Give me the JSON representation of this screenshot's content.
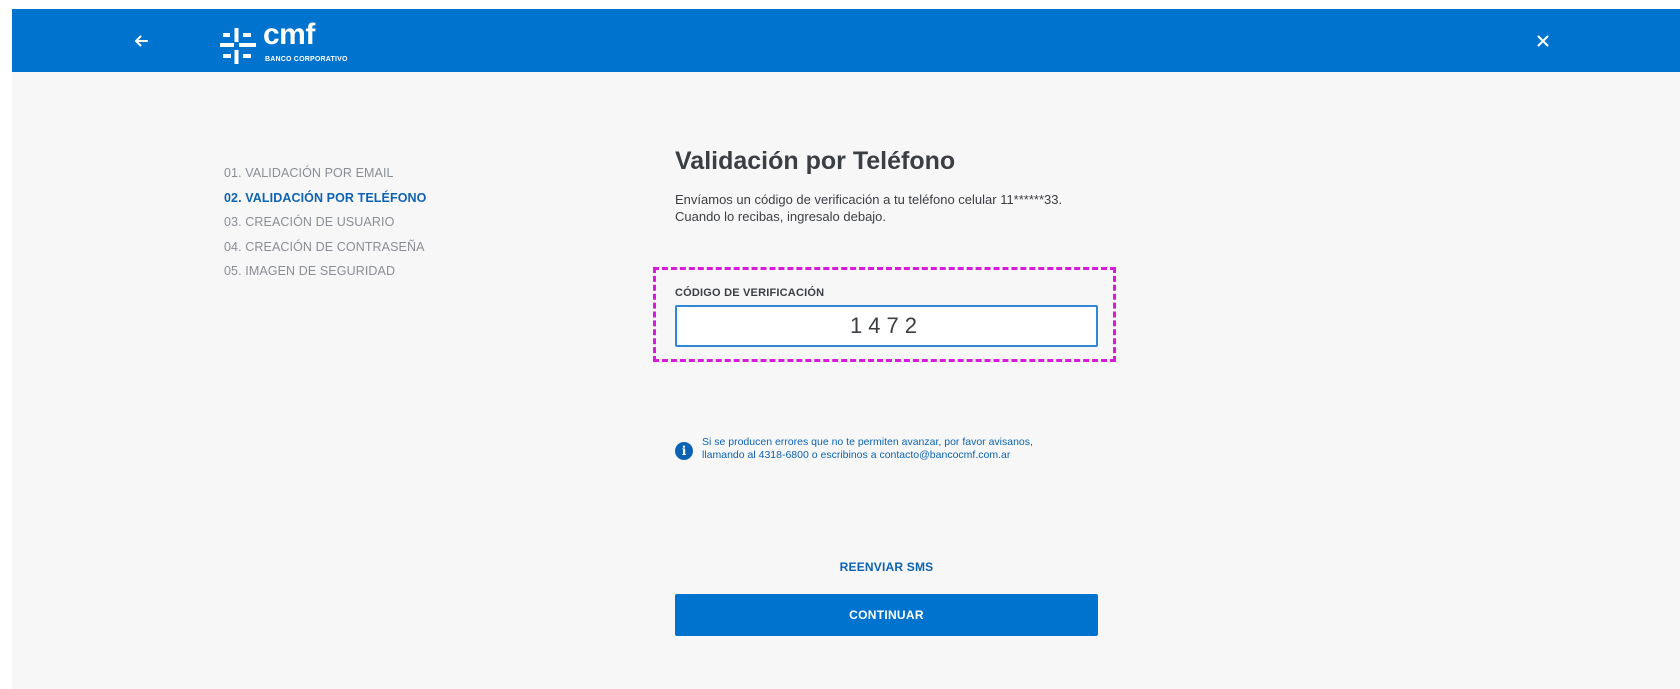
{
  "header": {
    "brand_name": "cmf",
    "brand_subtitle": "BANCO CORPORATIVO",
    "back_icon": "arrow-left-icon",
    "close_icon": "close-icon",
    "bar_color": "#0073cf"
  },
  "steps": [
    {
      "label": "01. VALIDACIÓN POR EMAIL",
      "active": false
    },
    {
      "label": "02. VALIDACIÓN POR TELÉFONO",
      "active": true
    },
    {
      "label": "03. CREACIÓN DE USUARIO",
      "active": false
    },
    {
      "label": "04. CREACIÓN DE CONTRASEÑA",
      "active": false
    },
    {
      "label": "05. IMAGEN DE SEGURIDAD",
      "active": false
    }
  ],
  "main": {
    "title": "Validación por Teléfono",
    "description_line1": "Envíamos un código de verificación a tu teléfono celular 11******33.",
    "description_line2": "Cuando lo recibas, ingresalo debajo.",
    "code_label": "CÓDIGO DE VERIFICACIÓN",
    "code_value": "1472",
    "info_icon": "info-icon",
    "info_line1": "Si se producen errores que no te permiten avanzar, por favor avisanos,",
    "info_line2": "llamando al 4318-6800 o escribinos a contacto@bancocmf.com.ar",
    "resend_label": "REENVIAR SMS",
    "continue_label": "CONTINUAR"
  },
  "colors": {
    "accent": "#0073cf",
    "link": "#0d63b3",
    "highlight": "#d81bdb",
    "background": "#f7f7f8"
  }
}
